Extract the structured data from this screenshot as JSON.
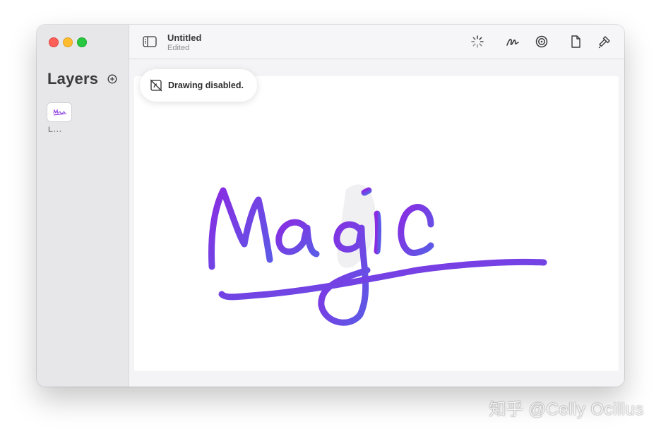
{
  "window": {
    "title": "Untitled",
    "subtitle": "Edited"
  },
  "sidebar": {
    "title": "Layers",
    "layers": [
      {
        "name": "L..."
      }
    ]
  },
  "toolbar": {
    "tools": [
      "loading-icon",
      "pen-icon",
      "target-icon",
      "document-icon",
      "hammer-icon"
    ]
  },
  "toast": {
    "text": "Drawing disabled."
  },
  "canvas": {
    "drawing_text": "Magic"
  },
  "watermark": {
    "text": "知乎 @Celly Ocillus"
  },
  "colors": {
    "stroke_start": "#8a2be2",
    "stroke_end": "#5b5be6",
    "sidebar_bg": "#e7e7ea",
    "close": "#fe5f57",
    "minimize": "#febc2e",
    "maximize": "#28c840"
  }
}
